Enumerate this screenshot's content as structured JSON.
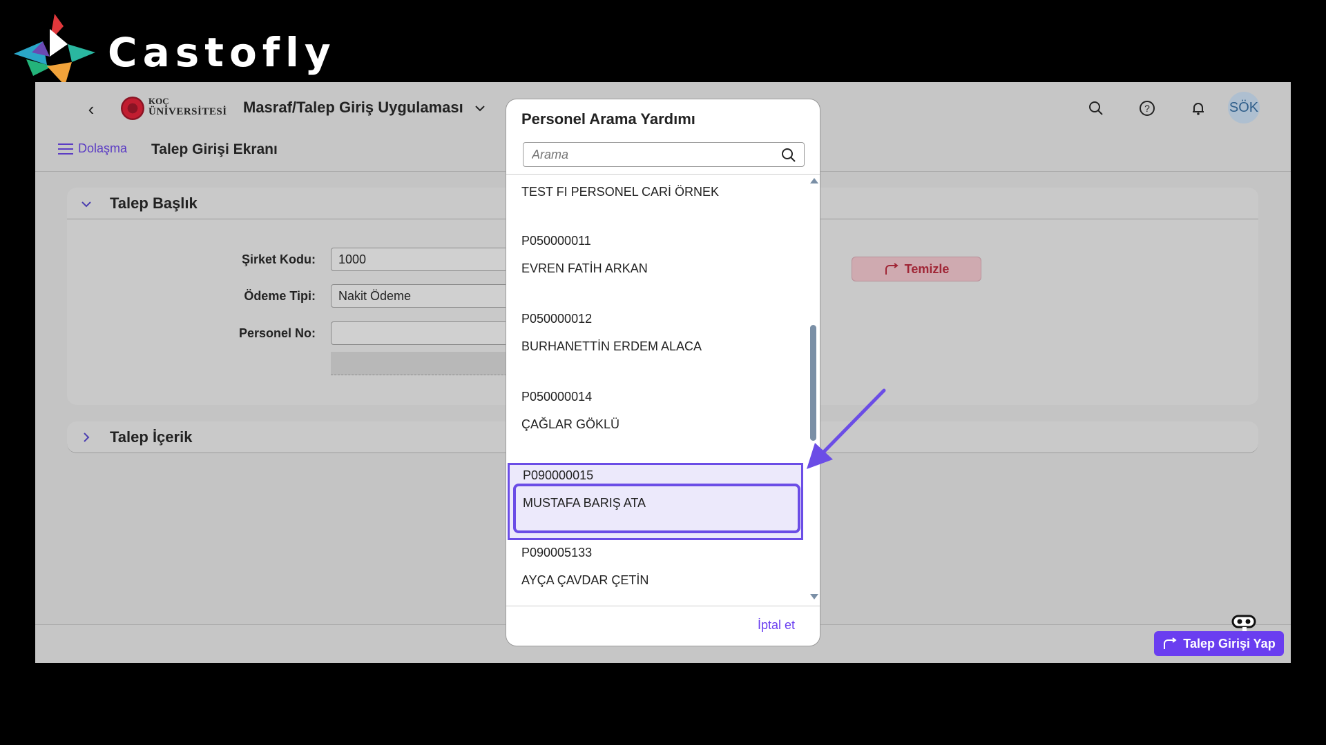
{
  "brand": {
    "name": "Castofly"
  },
  "shell": {
    "university_line1": "KOÇ",
    "university_line2": "ÜNİVERSİTESİ",
    "app_title": "Masraf/Talep Giriş Uygulaması",
    "avatar_initials": "SÖK"
  },
  "subbar": {
    "menu_label": "Dolaşma",
    "page_title": "Talep Girişi Ekranı"
  },
  "panel_header": {
    "title": "Talep Başlık",
    "fields": {
      "company_label": "Şirket Kodu:",
      "company_value": "1000",
      "payment_label": "Ödeme Tipi:",
      "payment_value": "Nakit Ödeme",
      "personnel_label": "Personel No:",
      "personnel_value": ""
    },
    "clear_label": "Temizle"
  },
  "panel_content": {
    "title": "Talep İçerik"
  },
  "footer": {
    "submit_label": "Talep Girişi Yap"
  },
  "dialog": {
    "title": "Personel Arama Yardımı",
    "search_placeholder": "Arama",
    "cancel_label": "İptal et",
    "items": [
      {
        "code": "",
        "name": "TEST FI PERSONEL CARİ ÖRNEK"
      },
      {
        "code": "P050000011",
        "name": "EVREN FATİH ARKAN"
      },
      {
        "code": "P050000012",
        "name": "BURHANETTİN ERDEM ALACA"
      },
      {
        "code": "P050000014",
        "name": "ÇAĞLAR GÖKLÜ"
      },
      {
        "code": "P090000015",
        "name": "MUSTAFA BARIŞ ATA",
        "selected": true
      },
      {
        "code": "P090005133",
        "name": "AYÇA ÇAVDAR ÇETİN"
      }
    ]
  },
  "colors": {
    "accent": "#6a3ef0",
    "highlight": "#6b4de6",
    "danger": "#a02636"
  },
  "icons": [
    "back-icon",
    "chevron-down-icon",
    "search-icon",
    "help-icon",
    "bell-icon",
    "menu-icon",
    "redo-icon",
    "share-icon",
    "robot-icon"
  ]
}
